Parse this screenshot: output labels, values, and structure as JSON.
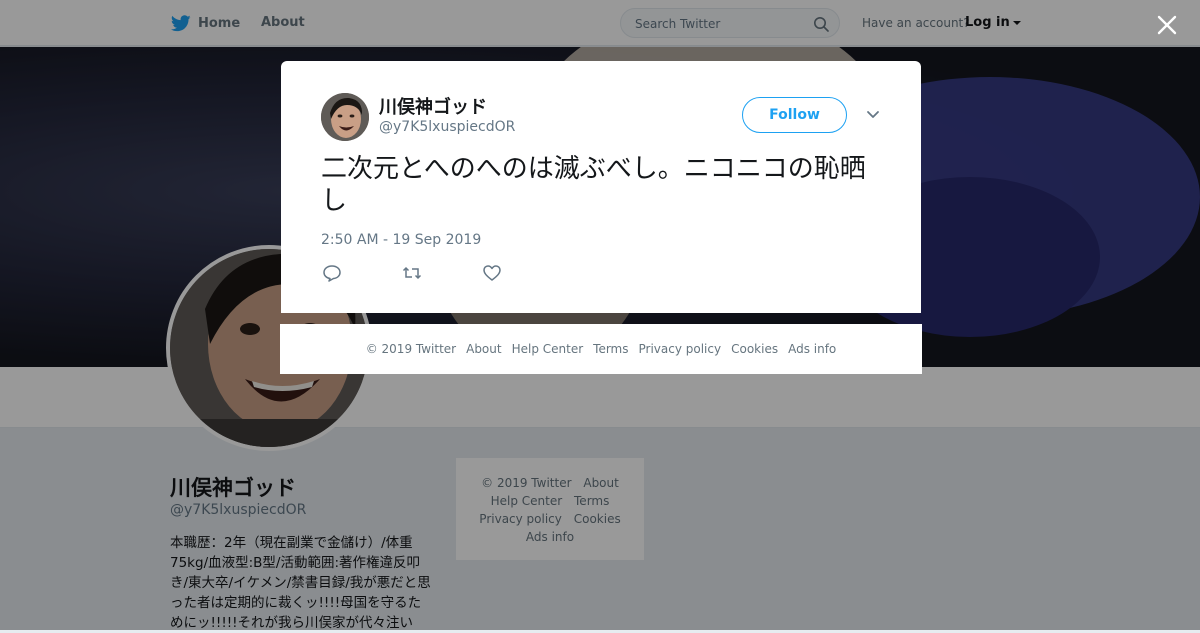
{
  "nav": {
    "home_label": "Home",
    "about_label": "About",
    "search_placeholder": "Search Twitter",
    "account_prompt": "Have an account?",
    "login_label": "Log in"
  },
  "profile": {
    "name": "川俣神ゴッド",
    "handle": "@y7K5lxuspiecdOR",
    "bio": "本職歴：2年（現在副業で金儲け）/体重75kg/血液型:B型/活動範囲:著作権違反叩き/東大卒/イケメン/禁書目録/我が悪だと思った者は定期的に裁くッ!!!!母国を守るためにッ!!!!!それが我ら川俣家が代々注い"
  },
  "side_footer": {
    "items": [
      "© 2019 Twitter",
      "About",
      "Help Center",
      "Terms",
      "Privacy policy",
      "Cookies",
      "Ads info"
    ]
  },
  "tweet": {
    "author_name": "川俣神ゴッド",
    "author_handle": "@y7K5lxuspiecdOR",
    "follow_label": "Follow",
    "text": "二次元とへのへのは滅ぶべし。ニコニコの恥晒し",
    "timestamp": "2:50 AM - 19 Sep 2019"
  },
  "modal_footer": {
    "items": [
      "© 2019 Twitter",
      "About",
      "Help Center",
      "Terms",
      "Privacy policy",
      "Cookies",
      "Ads info"
    ]
  },
  "icons": {
    "brand": "twitter-bird-icon",
    "search": "search-icon",
    "close": "close-icon",
    "chevron": "chevron-down-icon",
    "reply": "reply-icon",
    "retweet": "retweet-icon",
    "like": "heart-icon"
  },
  "colors": {
    "brand_blue": "#1da1f2",
    "secondary_text": "#657786",
    "background": "#e6ecf0"
  }
}
